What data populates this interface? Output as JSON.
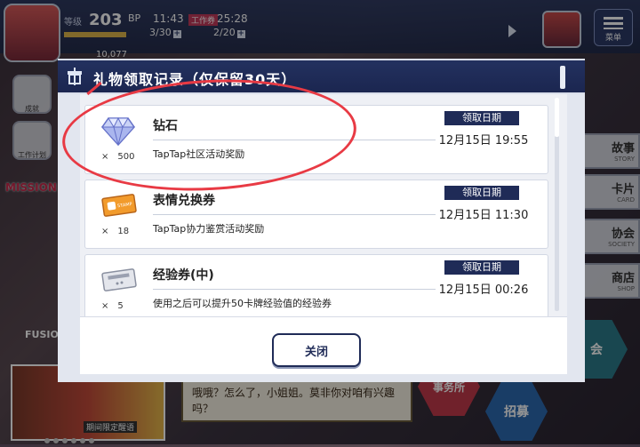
{
  "hud": {
    "level_label": "等级",
    "level": "203",
    "bp_label": "BP",
    "bp_time": "11:43",
    "bp_count": "3/30",
    "work_label": "工作券",
    "work_time": "25:28",
    "work_count": "2/20",
    "money": "10,077",
    "menu_label": "菜单"
  },
  "side_left": [
    {
      "label": "成就"
    },
    {
      "label": "工作计划"
    }
  ],
  "mission_label": "MISSION",
  "fusion_label": "FUSIO",
  "side_right": [
    {
      "title": "故事",
      "sub": "STORY"
    },
    {
      "title": "卡片",
      "sub": "CARD"
    },
    {
      "title": "协会",
      "sub": "SOCIETY"
    },
    {
      "title": "商店",
      "sub": "SHOP"
    }
  ],
  "hexes": [
    {
      "label": "会"
    },
    {
      "label": "事务所"
    },
    {
      "label": "招募"
    }
  ],
  "dialog_text": "哦哦？怎么了，小姐姐。莫非你对咱有兴趣吗？",
  "banner_subtitle": "期间限定醒语",
  "modal": {
    "title": "礼物领取记录（仅保留30天）",
    "close_label": "关闭",
    "items": [
      {
        "icon": "diamond-icon",
        "name": "钻石",
        "qty": "500",
        "desc": "TapTap社区活动奖励",
        "date_label": "领取日期",
        "date": "12月15日 19:55"
      },
      {
        "icon": "stamp-ticket-icon",
        "name": "表情兑换券",
        "qty": "18",
        "desc": "TapTap协力鉴赏活动奖励",
        "date_label": "领取日期",
        "date": "12月15日 11:30"
      },
      {
        "icon": "exp-ticket-icon",
        "name": "经验券(中)",
        "qty": "5",
        "desc": "使用之后可以提升50卡牌经验值的经验券",
        "date_label": "领取日期",
        "date": "12月15日 00:26"
      }
    ]
  },
  "colors": {
    "header_navy": "#1f2b57",
    "annotation_red": "#e83a44"
  }
}
